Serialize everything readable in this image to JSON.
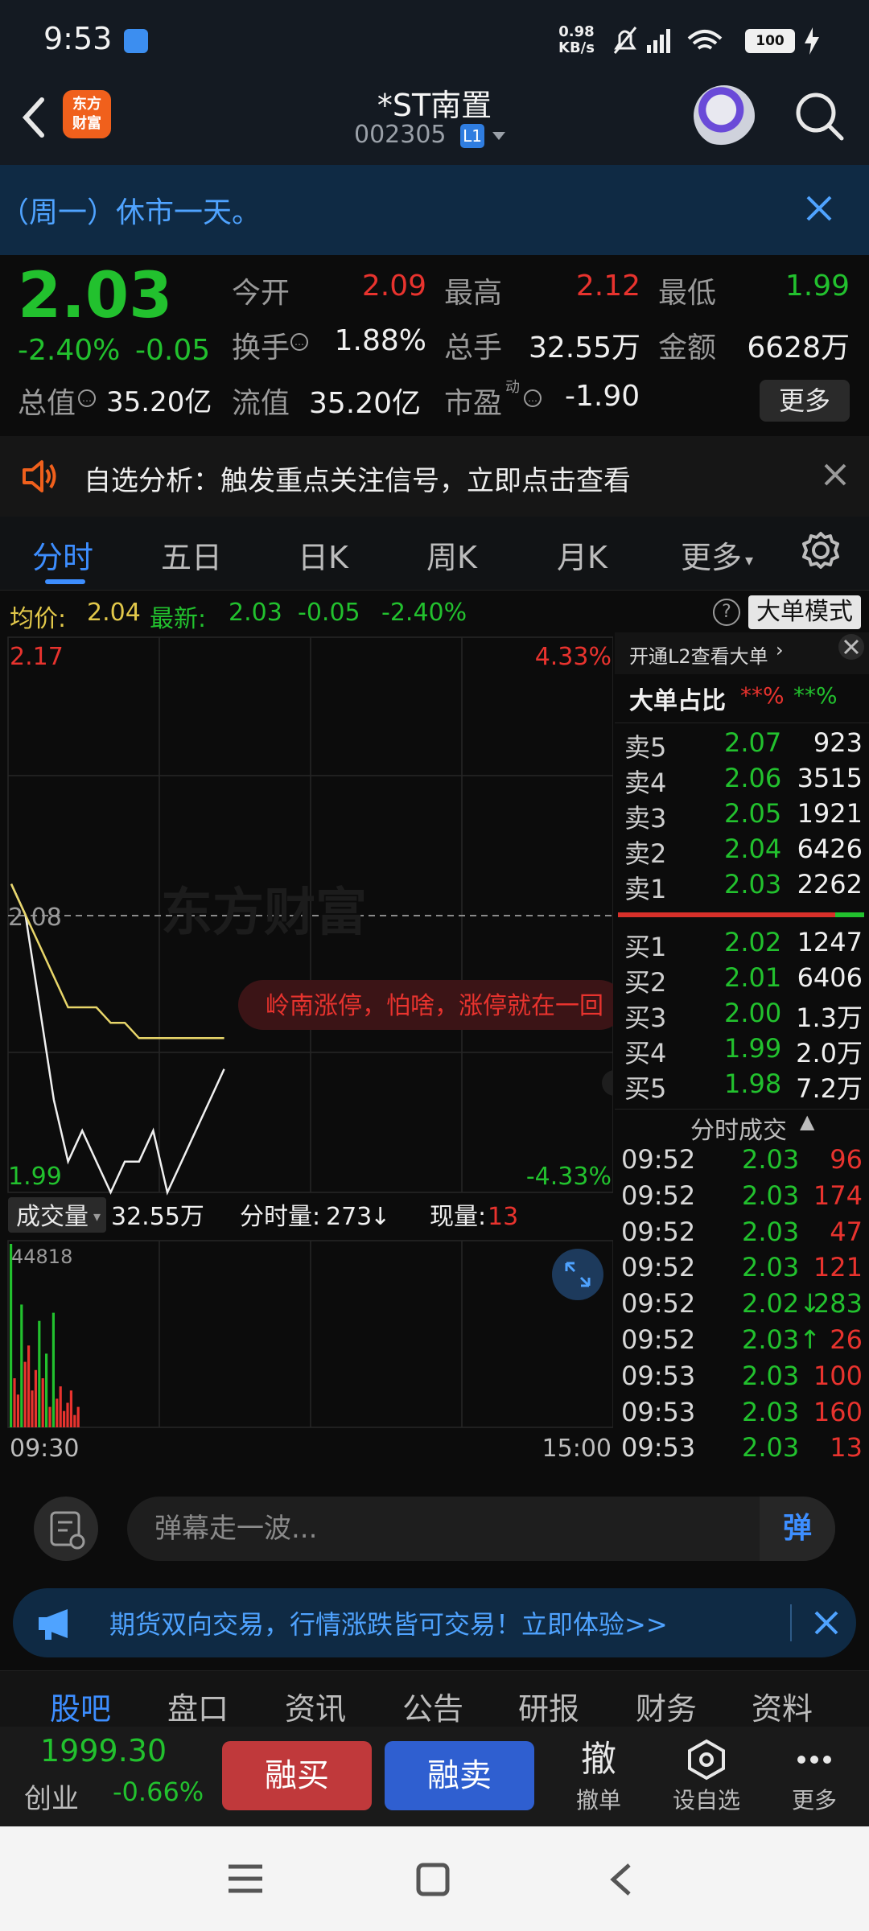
{
  "status": {
    "time": "9:53",
    "net_speed_value": "0.98",
    "net_speed_unit": "KB/s",
    "battery": "100"
  },
  "header": {
    "back_label": "返回",
    "logo_text": "东方财富",
    "stock_name": "*ST南置",
    "stock_code": "002305",
    "level_badge": "L1"
  },
  "notice": {
    "text": "（周一）休市一天。"
  },
  "quote": {
    "price": "2.03",
    "change_pct": "-2.40%",
    "change": "-0.05",
    "fields": [
      {
        "label": "今开",
        "value": "2.09",
        "color": "red"
      },
      {
        "label": "最高",
        "value": "2.12",
        "color": "red"
      },
      {
        "label": "最低",
        "value": "1.99",
        "color": "green"
      },
      {
        "label": "换手",
        "value": "1.88%",
        "color": "white"
      },
      {
        "label": "总手",
        "value": "32.55万",
        "color": "white"
      },
      {
        "label": "金额",
        "value": "6628万",
        "color": "white"
      },
      {
        "label": "总值",
        "value": "35.20亿",
        "color": "white"
      },
      {
        "label": "流值",
        "value": "35.20亿",
        "color": "white"
      },
      {
        "label": "市盈",
        "value": "-1.90",
        "color": "white"
      }
    ],
    "pe_superscript": "动",
    "more_label": "更多"
  },
  "analysis": {
    "text": "自选分析：触发重点关注信号，立即点击查看"
  },
  "tabs": {
    "items": [
      "分时",
      "五日",
      "日K",
      "周K",
      "月K",
      "更多"
    ],
    "active": 0
  },
  "avg_info": {
    "avg_label": "均价:",
    "avg_value": "2.04",
    "latest_label": "最新:",
    "latest_value": "2.03",
    "latest_change": "-0.05",
    "latest_pct": "-2.40%",
    "big_order_mode": "大单模式"
  },
  "chart_data": {
    "type": "line",
    "price_axis": {
      "max": "2.17",
      "mid": "2.08",
      "min": "1.99",
      "max_pct": "4.33%",
      "min_pct": "-4.33%"
    },
    "ylim": [
      1.99,
      2.17
    ],
    "x_start": "09:30",
    "x_end": "15:00",
    "series": [
      {
        "name": "最新",
        "color": "#f0f0f0",
        "values": [
          2.09,
          2.08,
          2.05,
          2.02,
          2.0,
          2.01,
          2.0,
          1.99,
          2.0,
          2.0,
          2.01,
          1.99,
          2.0,
          2.01,
          2.02,
          2.03
        ]
      },
      {
        "name": "均价",
        "color": "#e8d66a",
        "values": [
          2.09,
          2.08,
          2.07,
          2.06,
          2.05,
          2.05,
          2.05,
          2.045,
          2.045,
          2.04,
          2.04,
          2.04,
          2.04,
          2.04,
          2.04,
          2.04
        ]
      }
    ],
    "watermark": "东方财富",
    "comment": "岭南涨停，怕啥，涨停就在一回"
  },
  "volume": {
    "label": "成交量",
    "total": "32.55万",
    "fenshi_label": "分时量:",
    "fenshi_value": "273",
    "current_label": "现量:",
    "current_value": "13",
    "max_tick": "44818",
    "bars": [
      {
        "v": 44818,
        "c": "g"
      },
      {
        "v": 12000,
        "c": "r"
      },
      {
        "v": 8000,
        "c": "r"
      },
      {
        "v": 30000,
        "c": "g"
      },
      {
        "v": 16000,
        "c": "r"
      },
      {
        "v": 20000,
        "c": "r"
      },
      {
        "v": 9000,
        "c": "r"
      },
      {
        "v": 14000,
        "c": "r"
      },
      {
        "v": 26000,
        "c": "g"
      },
      {
        "v": 12000,
        "c": "r"
      },
      {
        "v": 18000,
        "c": "g"
      },
      {
        "v": 5000,
        "c": "r"
      },
      {
        "v": 28000,
        "c": "g"
      },
      {
        "v": 7000,
        "c": "r"
      },
      {
        "v": 10000,
        "c": "r"
      },
      {
        "v": 4000,
        "c": "r"
      },
      {
        "v": 6000,
        "c": "r"
      },
      {
        "v": 9000,
        "c": "r"
      },
      {
        "v": 3000,
        "c": "r"
      },
      {
        "v": 5000,
        "c": "r"
      }
    ]
  },
  "orderbook": {
    "l2_link": "开通L2查看大单",
    "big_ratio_label": "大单占比",
    "big_ratio_buy": "**%",
    "big_ratio_sell": "**%",
    "asks": [
      {
        "label": "卖5",
        "price": "2.07",
        "vol": "923"
      },
      {
        "label": "卖4",
        "price": "2.06",
        "vol": "3515"
      },
      {
        "label": "卖3",
        "price": "2.05",
        "vol": "1921"
      },
      {
        "label": "卖2",
        "price": "2.04",
        "vol": "6426"
      },
      {
        "label": "卖1",
        "price": "2.03",
        "vol": "2262"
      }
    ],
    "bids": [
      {
        "label": "买1",
        "price": "2.02",
        "vol": "1247"
      },
      {
        "label": "买2",
        "price": "2.01",
        "vol": "6406"
      },
      {
        "label": "买3",
        "price": "2.00",
        "vol": "1.3万"
      },
      {
        "label": "买4",
        "price": "1.99",
        "vol": "2.0万"
      },
      {
        "label": "买5",
        "price": "1.98",
        "vol": "7.2万"
      }
    ],
    "trades_title": "分时成交",
    "trades": [
      {
        "time": "09:52",
        "price": "2.03",
        "vol": "96",
        "dir": "r"
      },
      {
        "time": "09:52",
        "price": "2.03",
        "vol": "174",
        "dir": "r"
      },
      {
        "time": "09:52",
        "price": "2.03",
        "vol": "47",
        "dir": "r"
      },
      {
        "time": "09:52",
        "price": "2.03",
        "vol": "121",
        "dir": "r"
      },
      {
        "time": "09:52",
        "price": "2.02↓",
        "vol": "283",
        "dir": "g"
      },
      {
        "time": "09:52",
        "price": "2.03↑",
        "vol": "26",
        "dir": "r"
      },
      {
        "time": "09:53",
        "price": "2.03",
        "vol": "100",
        "dir": "r"
      },
      {
        "time": "09:53",
        "price": "2.03",
        "vol": "160",
        "dir": "r"
      },
      {
        "time": "09:53",
        "price": "2.03",
        "vol": "13",
        "dir": "r"
      }
    ]
  },
  "danmu": {
    "placeholder": "弹幕走一波...",
    "send_label": "弹"
  },
  "promo": {
    "text": "期货双向交易，行情涨跌皆可交易！立即体验>>"
  },
  "bottom_tabs": {
    "items": [
      "股吧",
      "盘口",
      "资讯",
      "公告",
      "研报",
      "财务",
      "资料"
    ],
    "active": 0
  },
  "actions": {
    "index_value": "1999.30",
    "index_name": "创业",
    "index_pct": "-0.66%",
    "buy_label": "融买",
    "sell_label": "融卖",
    "cancel_icon": "撤",
    "cancel_label": "撤单",
    "watch_label": "设自选",
    "more_label": "更多"
  }
}
